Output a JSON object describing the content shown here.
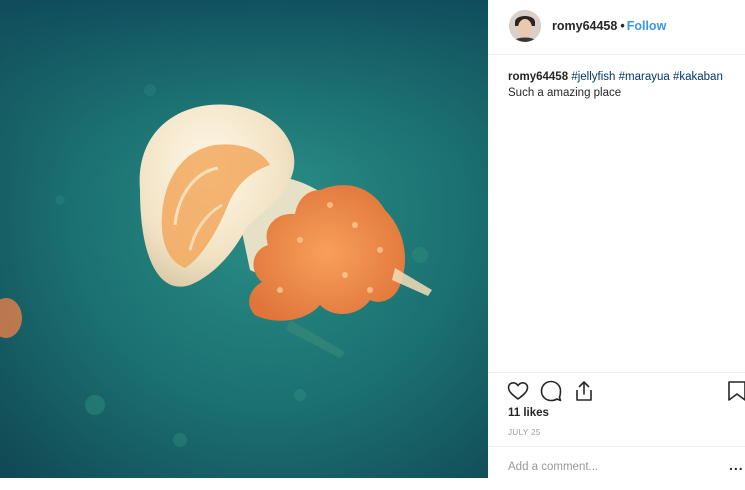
{
  "post": {
    "username": "romy64458",
    "separator": "•",
    "follow_label": "Follow",
    "caption": {
      "username": "romy64458",
      "tags": [
        "#jellyfish",
        "#marayua",
        "#kakaban"
      ],
      "text": "Such a amazing place"
    },
    "likes": "11 likes",
    "date": "JULY 25",
    "comment_placeholder": "Add a comment...",
    "more_label": "..."
  },
  "icons": {
    "like": "heart-icon",
    "comment": "comment-icon",
    "share": "share-icon",
    "save": "bookmark-icon",
    "more": "more-options-icon"
  },
  "colors": {
    "link_blue": "#3897f0",
    "hashtag": "#003569",
    "muted": "#999999",
    "water": "#1f7a78"
  }
}
